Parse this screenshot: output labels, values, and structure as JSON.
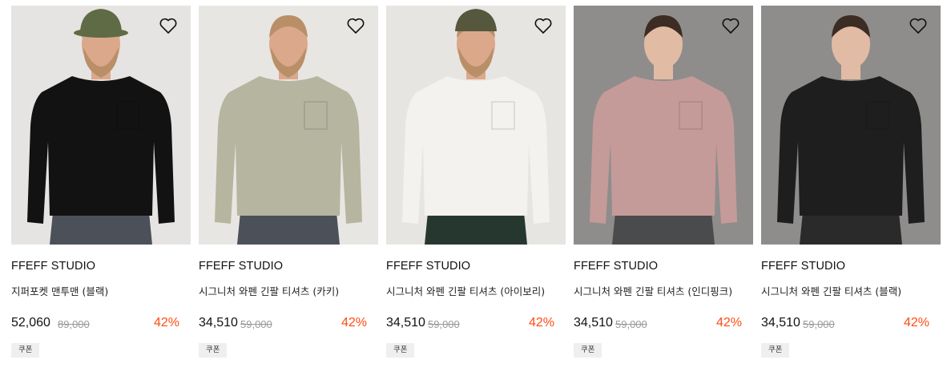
{
  "colors": {
    "discount": "#ff4b12",
    "strike": "#9a9a9a",
    "coupon_bg": "#efefef"
  },
  "products": [
    {
      "brand": "FFEFF STUDIO",
      "name": "지퍼포켓 맨투맨 (블랙)",
      "price": "52,060",
      "original_price": "89,000",
      "discount": "42%",
      "badge": "쿠폰",
      "icon": "heart-outline-icon",
      "photo_colors": {
        "bg": "#e6e4e2",
        "garment": "#121212",
        "skin": "#dba88c",
        "hair": "#b98f68",
        "hat": "#5f6b44",
        "pants": "#4c5058"
      }
    },
    {
      "brand": "FFEFF STUDIO",
      "name": "시그니처 와펜 긴팔 티셔츠 (카키)",
      "price": "34,510",
      "original_price": "59,000",
      "discount": "42%",
      "badge": "쿠폰",
      "icon": "heart-outline-icon",
      "photo_colors": {
        "bg": "#e8e6e3",
        "garment": "#b6b59f",
        "skin": "#dba88c",
        "hair": "#b98f68",
        "hat": "",
        "pants": "#4c5058"
      }
    },
    {
      "brand": "FFEFF STUDIO",
      "name": "시그니처 와펜 긴팔 티셔츠 (아이보리)",
      "price": "34,510",
      "original_price": "59,000",
      "discount": "42%",
      "badge": "쿠폰",
      "icon": "heart-outline-icon",
      "photo_colors": {
        "bg": "#e7e5e2",
        "garment": "#f4f2ee",
        "skin": "#dba88c",
        "hair": "#b98f68",
        "hat": "#55583c",
        "pants": "#26372f"
      }
    },
    {
      "brand": "FFEFF STUDIO",
      "name": "시그니처 와펜 긴팔 티셔츠 (인디핑크)",
      "price": "34,510",
      "original_price": "59,000",
      "discount": "42%",
      "badge": "쿠폰",
      "icon": "heart-outline-icon",
      "photo_colors": {
        "bg": "#8e8d8c",
        "garment": "#c49b99",
        "skin": "#e2bba5",
        "hair": "#3b2c24",
        "hat": "",
        "pants": "#4a4b4c"
      }
    },
    {
      "brand": "FFEFF STUDIO",
      "name": "시그니처 와펜 긴팔 티셔츠 (블랙)",
      "price": "34,510",
      "original_price": "59,000",
      "discount": "42%",
      "badge": "쿠폰",
      "icon": "heart-outline-icon",
      "photo_colors": {
        "bg": "#8e8d8c",
        "garment": "#1e1e1e",
        "skin": "#e2bba5",
        "hair": "#3b2c24",
        "hat": "",
        "pants": "#2a2a2a"
      }
    }
  ]
}
